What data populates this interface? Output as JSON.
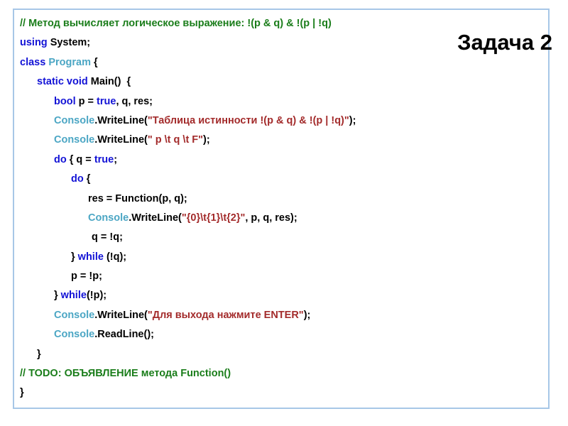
{
  "slide": {
    "title": "Задача 2",
    "frame_border_color": "#a7c7e7",
    "background_color": "#ffffff"
  },
  "syntax_colors": {
    "plain": "#000000",
    "keyword": "#1313d6",
    "type": "#4ba6c4",
    "string": "#a32b2b",
    "comment": "#1a7d1a"
  },
  "code": {
    "language": "csharp",
    "plain_text": "// Метод вычисляет логическое выражение: !(p & q) & !(p | !q)\nusing System;\nclass Program {\n   static void Main()  {\n      bool p = true, q, res;\n      Console.WriteLine(\"Таблица истинности !(p & q) & !(p | !q)\");\n      Console.WriteLine(\" p \\t q \\t F\");\n      do { q = true;\n         do {\n            res = Function(p, q);\n            Console.WriteLine(\"{0}\\t{1}\\t{2}\", p, q, res);\n             q = !q;\n         } while (!q);\n         p = !p;\n      } while(!p);\n      Console.WriteLine(\"Для выхода нажмите ENTER\");\n      Console.ReadLine();\n   }\n// TODO: ОБЪЯВЛЕНИЕ метода Function()\n}",
    "lines": [
      {
        "indent": 0,
        "tokens": [
          {
            "t": "// Метод вычисляет логическое выражение: !(p & q) & !(p | !q)",
            "c": "comment"
          }
        ]
      },
      {
        "indent": 0,
        "tokens": [
          {
            "t": "using",
            "c": "keyword"
          },
          {
            "t": " System;",
            "c": "plain"
          }
        ]
      },
      {
        "indent": 0,
        "tokens": [
          {
            "t": "class",
            "c": "keyword"
          },
          {
            "t": " ",
            "c": "plain"
          },
          {
            "t": "Program",
            "c": "type"
          },
          {
            "t": " {",
            "c": "plain"
          }
        ]
      },
      {
        "indent": 24,
        "tokens": [
          {
            "t": "static void",
            "c": "keyword"
          },
          {
            "t": " Main()  {",
            "c": "plain"
          }
        ]
      },
      {
        "indent": 48,
        "tokens": [
          {
            "t": "bool",
            "c": "keyword"
          },
          {
            "t": " p = ",
            "c": "plain"
          },
          {
            "t": "true",
            "c": "keyword"
          },
          {
            "t": ", q, res;",
            "c": "plain"
          }
        ]
      },
      {
        "indent": 48,
        "tokens": [
          {
            "t": "Console",
            "c": "type"
          },
          {
            "t": ".WriteLine(",
            "c": "plain"
          },
          {
            "t": "\"Таблица истинности !(p & q) & !(p | !q)\"",
            "c": "string"
          },
          {
            "t": ");",
            "c": "plain"
          }
        ]
      },
      {
        "indent": 48,
        "tokens": [
          {
            "t": "Console",
            "c": "type"
          },
          {
            "t": ".WriteLine(",
            "c": "plain"
          },
          {
            "t": "\" p \\t q \\t F\"",
            "c": "string"
          },
          {
            "t": ");",
            "c": "plain"
          }
        ]
      },
      {
        "indent": 48,
        "tokens": [
          {
            "t": "do",
            "c": "keyword"
          },
          {
            "t": " { q = ",
            "c": "plain"
          },
          {
            "t": "true",
            "c": "keyword"
          },
          {
            "t": ";",
            "c": "plain"
          }
        ]
      },
      {
        "indent": 72,
        "tokens": [
          {
            "t": "do",
            "c": "keyword"
          },
          {
            "t": " {",
            "c": "plain"
          }
        ]
      },
      {
        "indent": 96,
        "tokens": [
          {
            "t": "res = Function(p, q);",
            "c": "plain"
          }
        ]
      },
      {
        "indent": 96,
        "tokens": [
          {
            "t": "Console",
            "c": "type"
          },
          {
            "t": ".WriteLine(",
            "c": "plain"
          },
          {
            "t": "\"{0}\\t{1}\\t{2}\"",
            "c": "string"
          },
          {
            "t": ", p, q, res);",
            "c": "plain"
          }
        ]
      },
      {
        "indent": 101,
        "tokens": [
          {
            "t": "q = !q;",
            "c": "plain"
          }
        ]
      },
      {
        "indent": 72,
        "tokens": [
          {
            "t": "} ",
            "c": "plain"
          },
          {
            "t": "while",
            "c": "keyword"
          },
          {
            "t": " (!q);",
            "c": "plain"
          }
        ]
      },
      {
        "indent": 72,
        "tokens": [
          {
            "t": "p = !p;",
            "c": "plain"
          }
        ]
      },
      {
        "indent": 48,
        "tokens": [
          {
            "t": "} ",
            "c": "plain"
          },
          {
            "t": "while",
            "c": "keyword"
          },
          {
            "t": "(!p);",
            "c": "plain"
          }
        ]
      },
      {
        "indent": 48,
        "tokens": [
          {
            "t": "Console",
            "c": "type"
          },
          {
            "t": ".WriteLine(",
            "c": "plain"
          },
          {
            "t": "\"Для выхода нажмите ENTER\"",
            "c": "string"
          },
          {
            "t": ");",
            "c": "plain"
          }
        ]
      },
      {
        "indent": 48,
        "tokens": [
          {
            "t": "Console",
            "c": "type"
          },
          {
            "t": ".ReadLine();",
            "c": "plain"
          }
        ]
      },
      {
        "indent": 24,
        "tokens": [
          {
            "t": "}",
            "c": "plain"
          }
        ]
      },
      {
        "indent": 0,
        "tokens": [
          {
            "t": "// TODO: ОБЪЯВЛЕНИЕ метода Function()",
            "c": "comment"
          }
        ]
      },
      {
        "indent": 0,
        "tokens": [
          {
            "t": "}",
            "c": "plain"
          }
        ]
      }
    ]
  }
}
